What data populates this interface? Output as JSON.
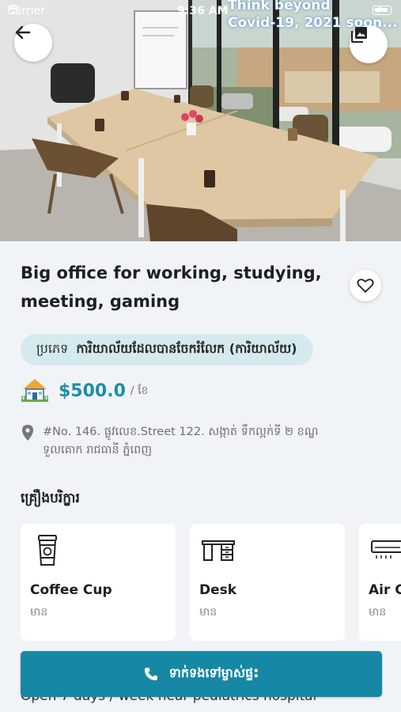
{
  "status_bar": {
    "carrier": "Carrier",
    "time": "9:36 AM"
  },
  "banner": {
    "line1": "Think beyond",
    "line2": "Covid-19, 2021 soon..."
  },
  "header": {
    "back_icon": "arrow-left-icon",
    "gallery_icon": "photo-library-icon"
  },
  "listing": {
    "title": "Big office for working, studying, meeting, gaming",
    "type_label": "ប្រភេទ",
    "type_value": "ការិយាល័យដែលបានចែករំលែក (ការិយាល័យ)",
    "price": "$500.0",
    "price_period": "/ ខែ",
    "address": "#No. 146. ផ្លូវលេខ.Street 122.  សង្កាត់ ទឹកល្អក់ទី ២ ខណ្ឌ ទួលគោក រាជធានី ភ្នំពេញ",
    "favorite_icon": "heart-outline-icon"
  },
  "amenities": {
    "title": "គ្រឿងបរិក្ខារ",
    "items": [
      {
        "name": "Coffee Cup",
        "status": "មាន",
        "icon": "coffee-cup-icon"
      },
      {
        "name": "Desk",
        "status": "មាន",
        "icon": "desk-icon"
      },
      {
        "name": "Air C",
        "status": "មាន",
        "icon": "air-conditioner-icon"
      }
    ]
  },
  "description_preview": "Open 7 days / week near pediatrics hospital",
  "call_button": {
    "label": "ទាក់ទងទៅម្ចាស់ផ្ទះ",
    "icon": "phone-icon"
  },
  "colors": {
    "accent": "#1687a5",
    "price": "#1c8ea8",
    "pill_bg": "#d5eaee"
  }
}
